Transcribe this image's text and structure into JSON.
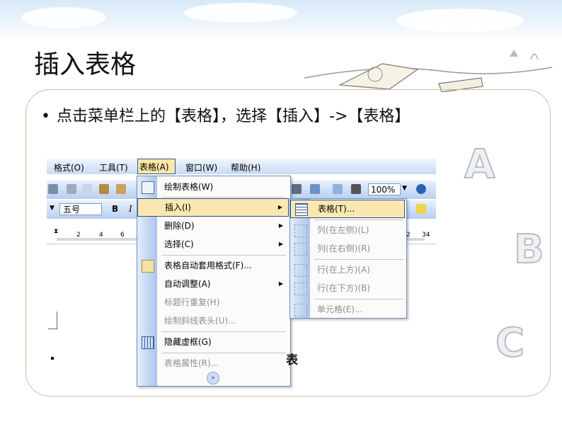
{
  "slide": {
    "title": "插入表格",
    "bullet": "点击菜单栏上的【表格】，选择【插入】->【表格】",
    "footer_fragment": "表"
  },
  "decor": {
    "letters": [
      "A",
      "B",
      "C"
    ]
  },
  "word": {
    "menubar": [
      {
        "label": "格式(O)"
      },
      {
        "label": "工具(T)"
      },
      {
        "label": "表格(A)"
      },
      {
        "label": "窗口(W)"
      },
      {
        "label": "帮助(H)"
      }
    ],
    "zoom": "100%",
    "font_size": "五号",
    "bold_label": "B",
    "italic_label": "I",
    "ruler_left": [
      "2",
      "4",
      "6"
    ],
    "ruler_right": [
      "2",
      "34"
    ]
  },
  "table_menu": {
    "items": [
      {
        "label": "绘制表格(W)",
        "enabled": true
      },
      {
        "label": "插入(I)",
        "enabled": true
      },
      {
        "label": "删除(D)",
        "enabled": true
      },
      {
        "label": "选择(C)",
        "enabled": true
      },
      {
        "label": "表格自动套用格式(F)...",
        "enabled": true
      },
      {
        "label": "自动调整(A)",
        "enabled": true
      },
      {
        "label": "标题行重复(H)",
        "enabled": false
      },
      {
        "label": "绘制斜线表头(U)...",
        "enabled": false
      },
      {
        "label": "隐藏虚框(G)",
        "enabled": true
      },
      {
        "label": "表格属性(R)...",
        "enabled": false
      }
    ],
    "expand_icon": "double-chevron-down-icon"
  },
  "insert_menu": {
    "items": [
      {
        "label": "表格(T)...",
        "enabled": true
      },
      {
        "label": "列(在左侧)(L)",
        "enabled": false
      },
      {
        "label": "列(在右侧)(R)",
        "enabled": false
      },
      {
        "label": "行(在上方)(A)",
        "enabled": false
      },
      {
        "label": "行(在下方)(B)",
        "enabled": false
      },
      {
        "label": "单元格(E)...",
        "enabled": false
      }
    ]
  },
  "colors": {
    "menu_highlight": "#fbe8b1",
    "menu_border": "#2b4f8f",
    "toolbar": "#c7daf4"
  }
}
